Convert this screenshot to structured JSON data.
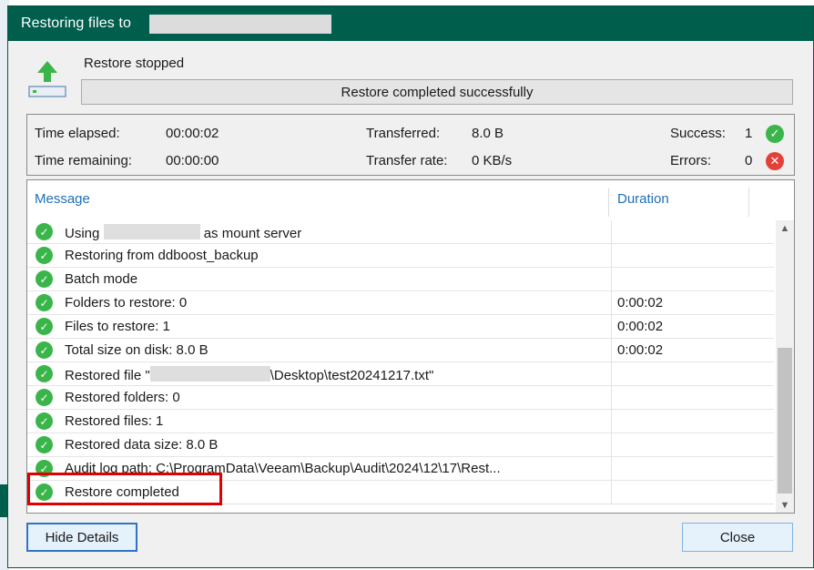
{
  "window": {
    "title": "Restoring files to"
  },
  "status": {
    "title": "Restore stopped",
    "progress_text": "Restore completed successfully",
    "progress_fraction": 1.0
  },
  "stats": {
    "time_elapsed_label": "Time elapsed:",
    "time_elapsed": "00:00:02",
    "time_remaining_label": "Time remaining:",
    "time_remaining": "00:00:00",
    "transferred_label": "Transferred:",
    "transferred": "8.0 B",
    "transfer_rate_label": "Transfer rate:",
    "transfer_rate": "0 KB/s",
    "success_label": "Success:",
    "success": "1",
    "errors_label": "Errors:",
    "errors": "0"
  },
  "log": {
    "columns": {
      "message": "Message",
      "duration": "Duration"
    },
    "rows": [
      {
        "message_pre": "Using",
        "message_post": "as mount server",
        "duration": ""
      },
      {
        "message": "Restoring from ddboost_backup",
        "duration": ""
      },
      {
        "message": "Batch mode",
        "duration": ""
      },
      {
        "message": "Folders to restore: 0",
        "duration": "0:00:02"
      },
      {
        "message": "Files to restore: 1",
        "duration": "0:00:02"
      },
      {
        "message": "Total size on disk: 8.0 B",
        "duration": "0:00:02"
      },
      {
        "message_pre": "Restored file \"",
        "message_post": "\\Desktop\\test20241217.txt\"",
        "duration": ""
      },
      {
        "message": "Restored folders: 0",
        "duration": ""
      },
      {
        "message": "Restored files: 1",
        "duration": ""
      },
      {
        "message": "Restored data size: 8.0 B",
        "duration": ""
      },
      {
        "message": "Audit log path: C:\\ProgramData\\Veeam\\Backup\\Audit\\2024\\12\\17\\Rest...",
        "duration": ""
      },
      {
        "message": "Restore completed",
        "duration": ""
      }
    ]
  },
  "buttons": {
    "hide_details": "Hide Details",
    "close": "Close"
  },
  "colors": {
    "titlebar": "#005e4d",
    "success_icon": "#3ab54a",
    "error_icon": "#e4403a",
    "column_header": "#1f6fb8",
    "highlight_box": "#e10000"
  },
  "icons": {
    "status": "upload-arrow-drive-icon",
    "row": "check-circle-icon",
    "success": "check-circle-icon",
    "errors": "x-circle-icon"
  }
}
